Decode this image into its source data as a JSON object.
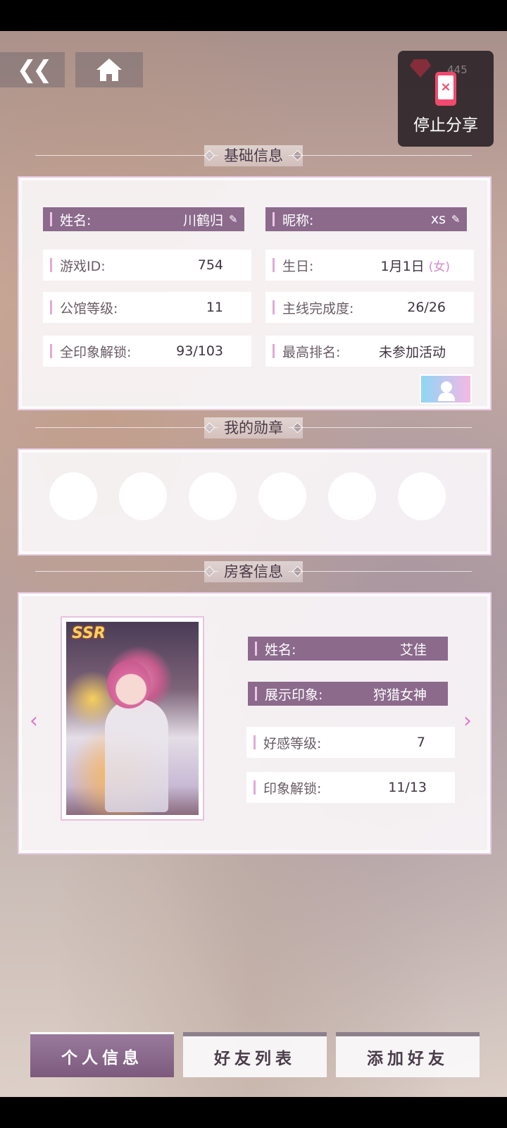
{
  "top": {
    "share_count": "445",
    "share_label": "停止分享"
  },
  "sections": {
    "basic": "基础信息",
    "medals": "我的勋章",
    "guest": "房客信息"
  },
  "basic_info": {
    "name_label": "姓名:",
    "name_value": "川鹤归",
    "nickname_label": "昵称:",
    "nickname_value": "xs",
    "game_id_label": "游戏ID:",
    "game_id_value": "754",
    "birthday_label": "生日:",
    "birthday_value": "1月1日",
    "gender": "(女)",
    "mansion_level_label": "公馆等级:",
    "mansion_level_value": "11",
    "main_progress_label": "主线完成度:",
    "main_progress_value": "26/26",
    "impressions_label": "全印象解锁:",
    "impressions_value": "93/103",
    "best_rank_label": "最高排名:",
    "best_rank_value": "未参加活动"
  },
  "guest_info": {
    "rarity": "SSR",
    "name_label": "姓名:",
    "name_value": "艾佳",
    "impression_label": "展示印象:",
    "impression_value": "狩猎女神",
    "affinity_label": "好感等级:",
    "affinity_value": "7",
    "unlock_label": "印象解锁:",
    "unlock_value": "11/13"
  },
  "tabs": [
    "个人信息",
    "好友列表",
    "添加好友"
  ]
}
